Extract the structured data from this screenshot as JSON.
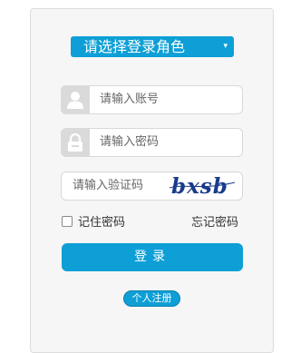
{
  "role_select": {
    "selected": "请选择登录角色",
    "arrow": "▾"
  },
  "account_field": {
    "placeholder": "请输入账号",
    "icon": "user-icon"
  },
  "password_field": {
    "placeholder": "请输入密码",
    "icon": "lock-icon"
  },
  "captcha_field": {
    "placeholder": "请输入验证码",
    "captcha_text": "bxsb"
  },
  "remember": {
    "label": "记住密码",
    "checked": false
  },
  "forgot_label": "忘记密码",
  "login_label": "登录",
  "register_label": "个人注册",
  "colors": {
    "accent": "#0e9fd6",
    "panel_bg": "#f6f6f6",
    "captcha_ink": "#1a3a8c"
  }
}
